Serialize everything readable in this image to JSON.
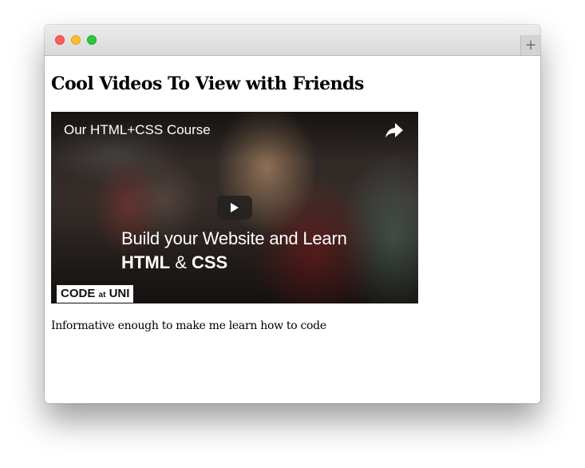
{
  "browser": {
    "new_tab_label": "+",
    "colors": {
      "close": "#ff5f57",
      "minimize": "#febc2e",
      "maximize": "#28c840"
    }
  },
  "page": {
    "heading": "Cool Videos To View with Friends",
    "video": {
      "title": "Our HTML+CSS Course",
      "overlay_line1": "Build your Website and Learn",
      "overlay_html": "HTML",
      "overlay_amp": " & ",
      "overlay_css": "CSS",
      "logo_code": "CODE ",
      "logo_at": "at",
      "logo_uni": " UNI",
      "icons": [
        "share-icon",
        "play-icon"
      ]
    },
    "caption": "Informative enough to make me learn how to code"
  }
}
